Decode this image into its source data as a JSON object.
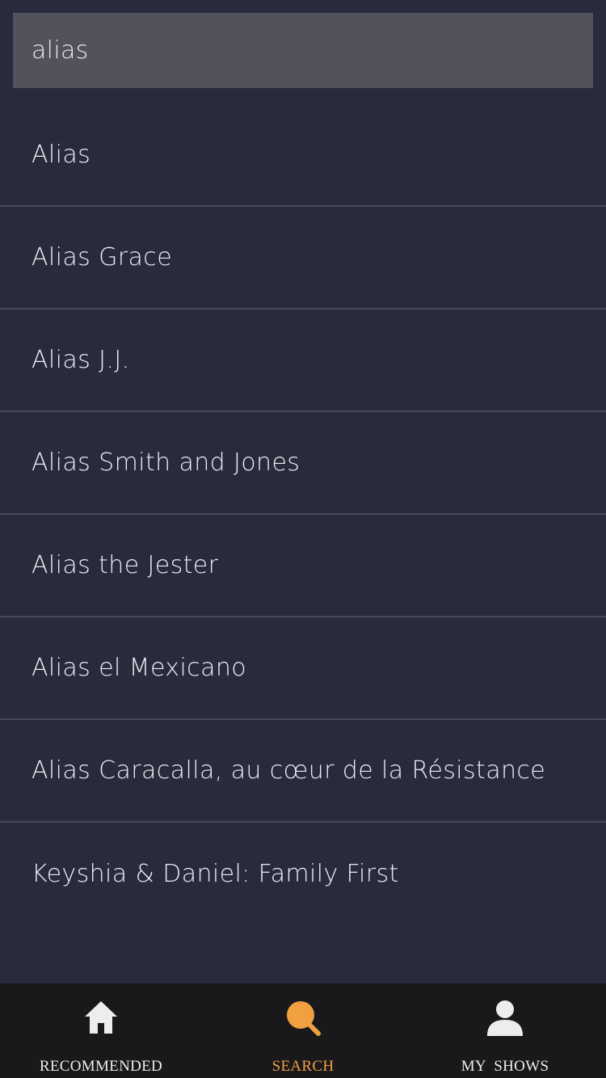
{
  "search": {
    "value": "alias"
  },
  "results": [
    "Alias",
    "Alias Grace",
    "Alias J.J.",
    "Alias Smith and Jones",
    "Alias the Jester",
    "Alias el Mexicano",
    "Alias Caracalla, au cœur de la Résistance",
    "Keyshia & Daniel: Family First"
  ],
  "tabbar": {
    "active_tab": "search",
    "accent_color": "#f0a040",
    "inactive_color": "#ededed",
    "tabs": [
      {
        "label": "RECOMMENDED",
        "icon": "home-icon"
      },
      {
        "label": "SEARCH",
        "icon": "search-icon"
      },
      {
        "label": "MY  SHOWS",
        "icon": "person-icon"
      }
    ]
  }
}
